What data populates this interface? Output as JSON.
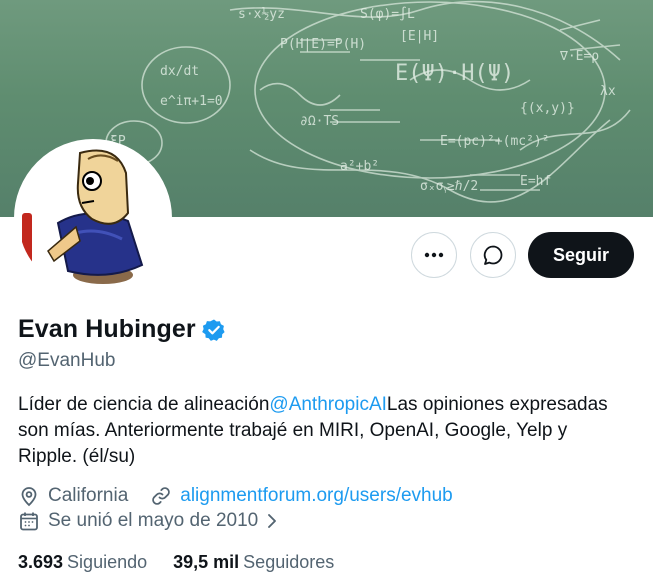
{
  "profile": {
    "name": "Evan Hubinger",
    "handle": "@EvanHub",
    "bio_prefix": "Líder de ciencia de alineación",
    "bio_mention": "@AnthropicAI",
    "bio_suffix": "Las opiniones expresadas son mías. Anteriormente trabajé en MIRI, OpenAI, Google, Yelp y Ripple. (él/su)",
    "location": "California",
    "website": "alignmentforum.org/users/evhub",
    "joined": "Se unió el mayo de 2010"
  },
  "actions": {
    "follow_label": "Seguir"
  },
  "stats": {
    "following_count": "3.693",
    "following_label": "Siguiendo",
    "followers_count": "39,5 mil",
    "followers_label": "Seguidores"
  },
  "icons": {
    "more": "more-horizontal-icon",
    "message": "message-icon",
    "verified": "verified-badge-icon",
    "location": "location-pin-icon",
    "link": "link-icon",
    "calendar": "calendar-icon",
    "chevron": "chevron-right-icon"
  },
  "colors": {
    "accent": "#1d9bf0",
    "text_primary": "#0f1419",
    "text_secondary": "#536471",
    "follow_bg": "#0f1419"
  }
}
